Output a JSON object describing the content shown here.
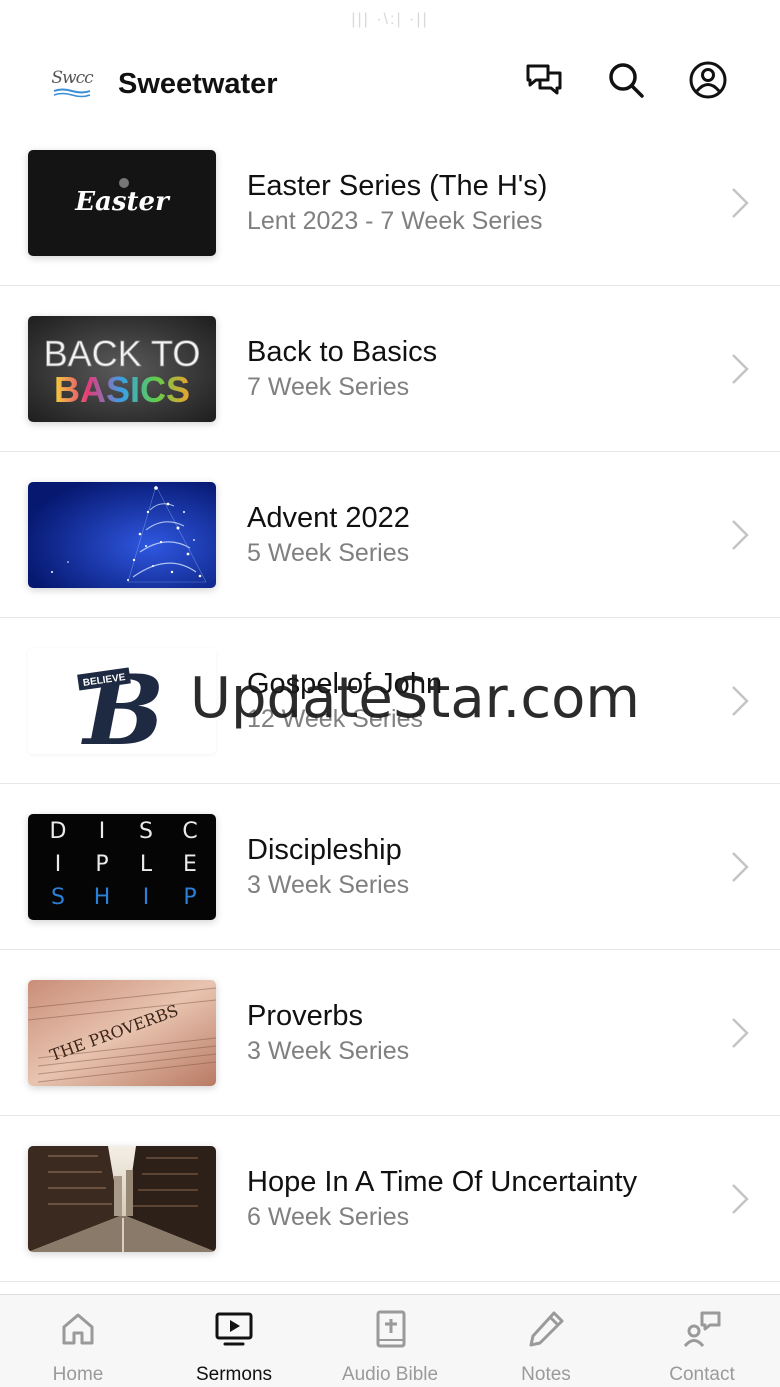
{
  "status_bar": {
    "text": "||| ·\\:| ·||"
  },
  "header": {
    "logo_text": "Swcc",
    "title": "Sweetwater",
    "icons": [
      "chat-icon",
      "search-icon",
      "profile-icon"
    ]
  },
  "sermons": [
    {
      "title": "Easter Series (The H's)",
      "subtitle": "Lent 2023 - 7 Week Series",
      "thumb_text": "Easter"
    },
    {
      "title": "Back to Basics",
      "subtitle": "7 Week Series",
      "thumb_text_1": "BACK TO",
      "thumb_text_2": "BASICS"
    },
    {
      "title": "Advent 2022",
      "subtitle": "5 Week Series"
    },
    {
      "title": "Gospel of John",
      "subtitle": "12 Week Series",
      "thumb_text_1": "BELIEVE",
      "thumb_text_2": "B"
    },
    {
      "title": "Discipleship",
      "subtitle": "3 Week Series",
      "thumb_letters": [
        "D",
        "I",
        "S",
        "C",
        "I",
        "P",
        "L",
        "E",
        "S",
        "H",
        "I",
        "P"
      ]
    },
    {
      "title": "Proverbs",
      "subtitle": "3 Week Series",
      "thumb_text": "THE PROVERBS"
    },
    {
      "title": "Hope In A Time Of Uncertainty",
      "subtitle": "6 Week Series"
    }
  ],
  "watermark": "UpdateStar.com",
  "tabs": [
    {
      "label": "Home",
      "icon": "home-icon",
      "active": false
    },
    {
      "label": "Sermons",
      "icon": "tv-play-icon",
      "active": true
    },
    {
      "label": "Audio Bible",
      "icon": "bible-icon",
      "active": false
    },
    {
      "label": "Notes",
      "icon": "pencil-icon",
      "active": false
    },
    {
      "label": "Contact",
      "icon": "contact-icon",
      "active": false
    }
  ],
  "colors": {
    "inactive_tab": "#9a9a9a",
    "active_tab": "#111111",
    "subtitle": "#808080",
    "accent_blue": "#2a7fd6"
  }
}
